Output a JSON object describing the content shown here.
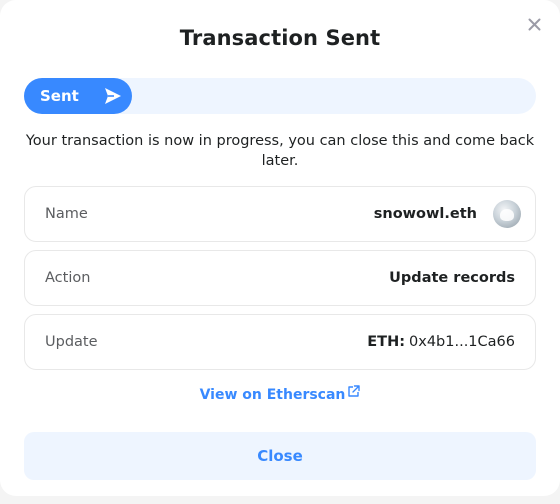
{
  "dialog": {
    "title": "Transaction Sent",
    "close_icon": "close-icon"
  },
  "progress": {
    "label": "Sent",
    "icon": "send-icon",
    "fraction": 0.21,
    "fill_color": "#3889ff",
    "track_color": "#eef5ff"
  },
  "message": "Your transaction is now in progress, you can close this and come back later.",
  "rows": [
    {
      "label": "Name",
      "value": "snowowl.eth",
      "avatar": "avatar-image"
    },
    {
      "label": "Action",
      "value": "Update records"
    },
    {
      "label": "Update",
      "value_key": "ETH:",
      "value": "0x4b1...1Ca66"
    }
  ],
  "link": {
    "label": "View on Etherscan",
    "icon": "external-link-icon"
  },
  "close_button": {
    "label": "Close"
  },
  "colors": {
    "accent": "#3889ff",
    "accent_light": "#eef5ff",
    "text": "#1e2122",
    "muted": "#5b5d60"
  }
}
